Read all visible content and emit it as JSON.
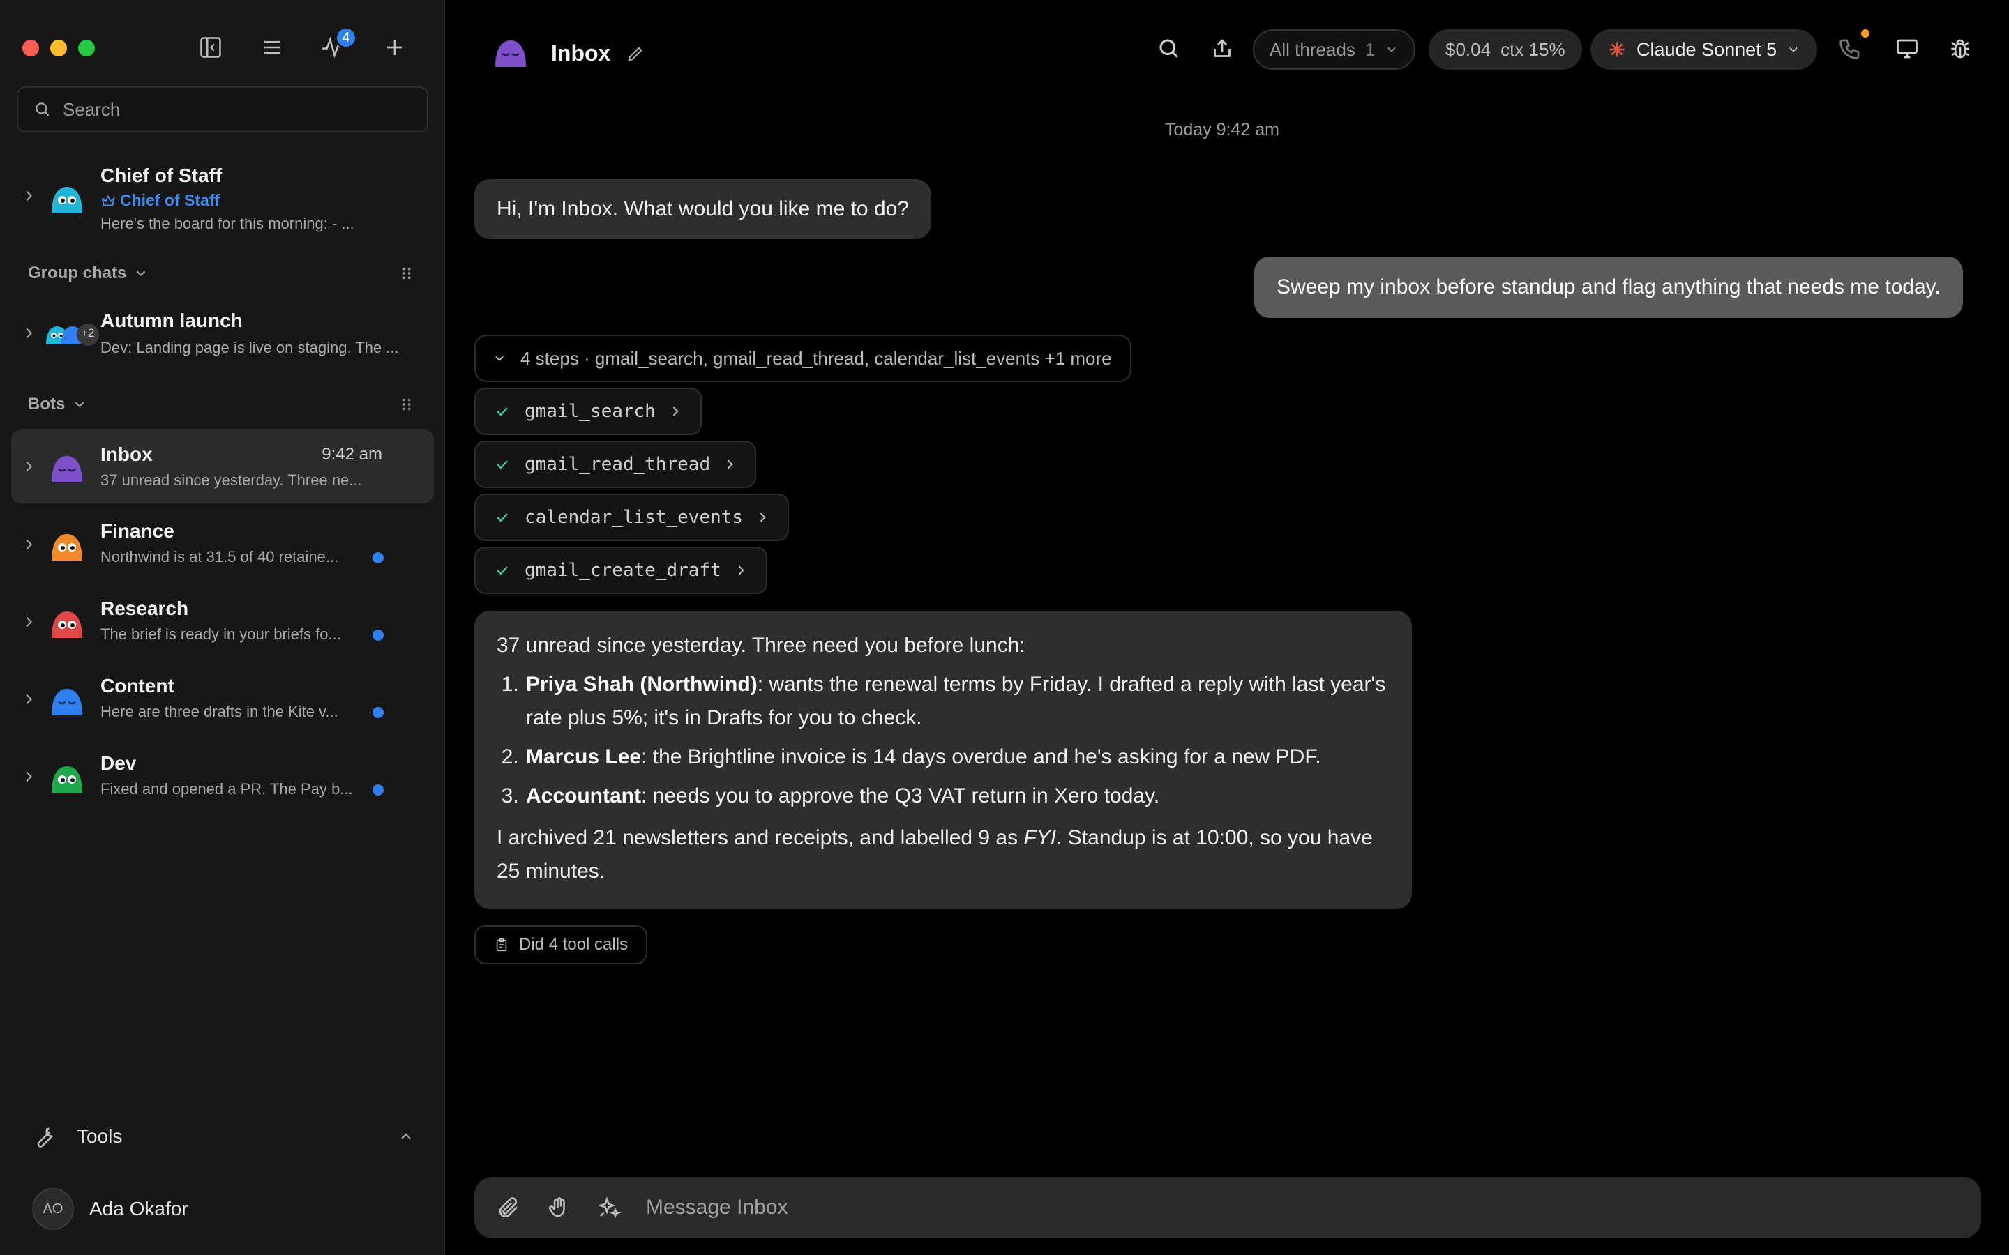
{
  "sidebar": {
    "notification_count": "4",
    "search_placeholder": "Search",
    "chief": {
      "title": "Chief of Staff",
      "role": "Chief of Staff",
      "preview": "Here's the board for this morning: - ..."
    },
    "group_section": "Group chats",
    "groups": [
      {
        "title": "Autumn launch",
        "extra": "+2",
        "preview": "Dev: Landing page is live on staging. The ..."
      }
    ],
    "bots_section": "Bots",
    "bots": [
      {
        "title": "Inbox",
        "time": "9:42 am",
        "preview": "37 unread since yesterday. Three ne...",
        "color": "#7e4fc9",
        "active": true
      },
      {
        "title": "Finance",
        "preview": "Northwind is at 31.5 of 40 retaine...",
        "color": "#f08a2c",
        "unread": true
      },
      {
        "title": "Research",
        "preview": "The brief is ready in your briefs fo...",
        "color": "#e04848",
        "unread": true
      },
      {
        "title": "Content",
        "preview": "Here are three drafts in the Kite v...",
        "color": "#2f7ff0",
        "unread": true
      },
      {
        "title": "Dev",
        "preview": "Fixed and opened a PR. The Pay b...",
        "color": "#1ea84b",
        "unread": true
      }
    ],
    "tools_label": "Tools",
    "user": {
      "initials": "AO",
      "name": "Ada Okafor"
    }
  },
  "header": {
    "title": "Inbox",
    "threads_label": "All threads",
    "threads_count": "1",
    "cost": "$0.04",
    "ctx": "ctx 15%",
    "model": "Claude Sonnet 5"
  },
  "chat": {
    "timestamp": "Today 9:42 am",
    "greeting": "Hi, I'm Inbox. What would you like me to do?",
    "user_message": "Sweep my inbox before standup and flag anything that needs me today.",
    "steps_summary": "4 steps · gmail_search, gmail_read_thread, calendar_list_events +1 more",
    "tools": [
      "gmail_search",
      "gmail_read_thread",
      "calendar_list_events",
      "gmail_create_draft"
    ],
    "answer": {
      "intro": "37 unread since yesterday. Three need you before lunch:",
      "items": [
        {
          "who": "Priya Shah (Northwind)",
          "text": ": wants the renewal terms by Friday. I drafted a reply with last year's rate plus 5%; it's in Drafts for you to check."
        },
        {
          "who": "Marcus Lee",
          "text": ": the Brightline invoice is 14 days overdue and he's asking for a new PDF."
        },
        {
          "who": "Accountant",
          "text": ": needs you to approve the Q3 VAT return in Xero today."
        }
      ],
      "tail_a": "I archived 21 newsletters and receipts, and labelled 9 as ",
      "tail_em": "FYI",
      "tail_b": ". Standup is at 10:00, so you have 25 minutes."
    },
    "tool_calls_label": "Did 4 tool calls"
  },
  "composer": {
    "placeholder": "Message Inbox"
  },
  "colors": {
    "accent": "#2f7ff0",
    "background": "#000000",
    "sidebar": "#171717",
    "bubble": "#2e2e2e",
    "user_bubble": "#5a5a5a"
  }
}
